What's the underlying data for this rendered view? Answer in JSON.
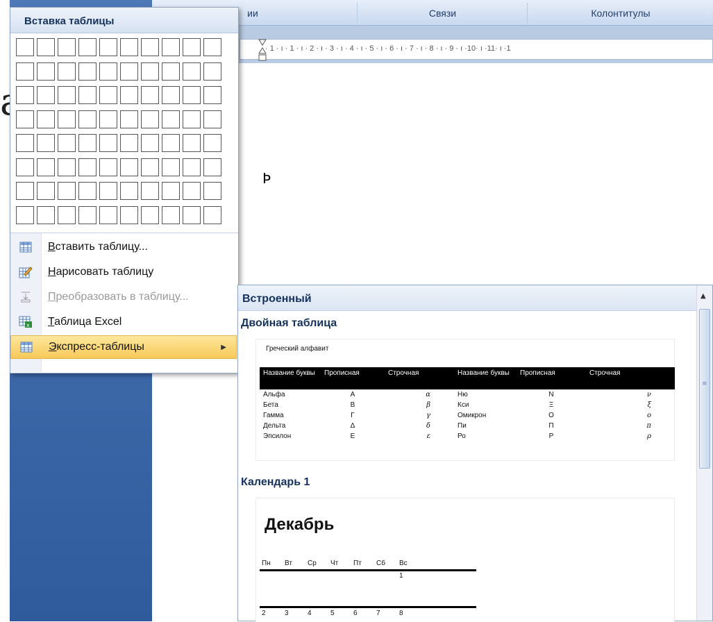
{
  "background_word": {
    "partial_char": "а",
    "cursor": "Þ",
    "ribbon_tabs": [
      "ии",
      "Связи",
      "Колонтитулы"
    ],
    "ruler_text": "· 1 · ı · 1 · ı · 2 · ı · 3 · ı · 4 · ı · 5 · ı · 6 · ı · 7 · ı · 8 · ı · 9 · ı ·10· ı ·11· ı ·1"
  },
  "insert_table_menu": {
    "title": "Вставка таблицы",
    "grid": {
      "columns": 10,
      "rows": 8
    },
    "items": [
      {
        "label": "Вставить таблицу...",
        "icon": "table-grid-icon",
        "enabled": true
      },
      {
        "label": "Нарисовать таблицу",
        "icon": "pencil-table-icon",
        "enabled": true
      },
      {
        "label": "Преобразовать в таблицу...",
        "icon": "convert-text-icon",
        "enabled": false
      },
      {
        "label": "Таблица Excel",
        "icon": "excel-table-icon",
        "enabled": true
      },
      {
        "label": "Экспресс-таблицы",
        "icon": "quick-tables-icon",
        "enabled": true,
        "highlighted": true,
        "submenu_arrow": "▶"
      }
    ]
  },
  "quick_tables_gallery": {
    "header": "Встроенный",
    "sections": [
      {
        "title": "Двойная таблица",
        "preview": {
          "caption": "Греческий алфавит",
          "columns": [
            "Название буквы",
            "Прописная",
            "Строчная",
            "Название буквы",
            "Прописная",
            "Строчная"
          ],
          "rows": [
            [
              "Альфа",
              "Α",
              "α",
              "Ню",
              "Ν",
              "ν"
            ],
            [
              "Бета",
              "Β",
              "β",
              "Кси",
              "Ξ",
              "ξ"
            ],
            [
              "Гамма",
              "Γ",
              "γ",
              "Омикрон",
              "Ο",
              "ο"
            ],
            [
              "Дельта",
              "Δ",
              "δ",
              "Пи",
              "Π",
              "π"
            ],
            [
              "Эпсилон",
              "Ε",
              "ε",
              "Ро",
              "Ρ",
              "ρ"
            ]
          ]
        }
      },
      {
        "title": "Календарь 1",
        "preview": {
          "month": "Декабрь",
          "weekdays": [
            "Пн",
            "Вт",
            "Ср",
            "Чт",
            "Пт",
            "Сб",
            "Вс"
          ],
          "week1": [
            "",
            "",
            "",
            "",
            "",
            "",
            "1"
          ],
          "week2": [
            "2",
            "3",
            "4",
            "5",
            "6",
            "7",
            "8"
          ]
        }
      }
    ]
  }
}
